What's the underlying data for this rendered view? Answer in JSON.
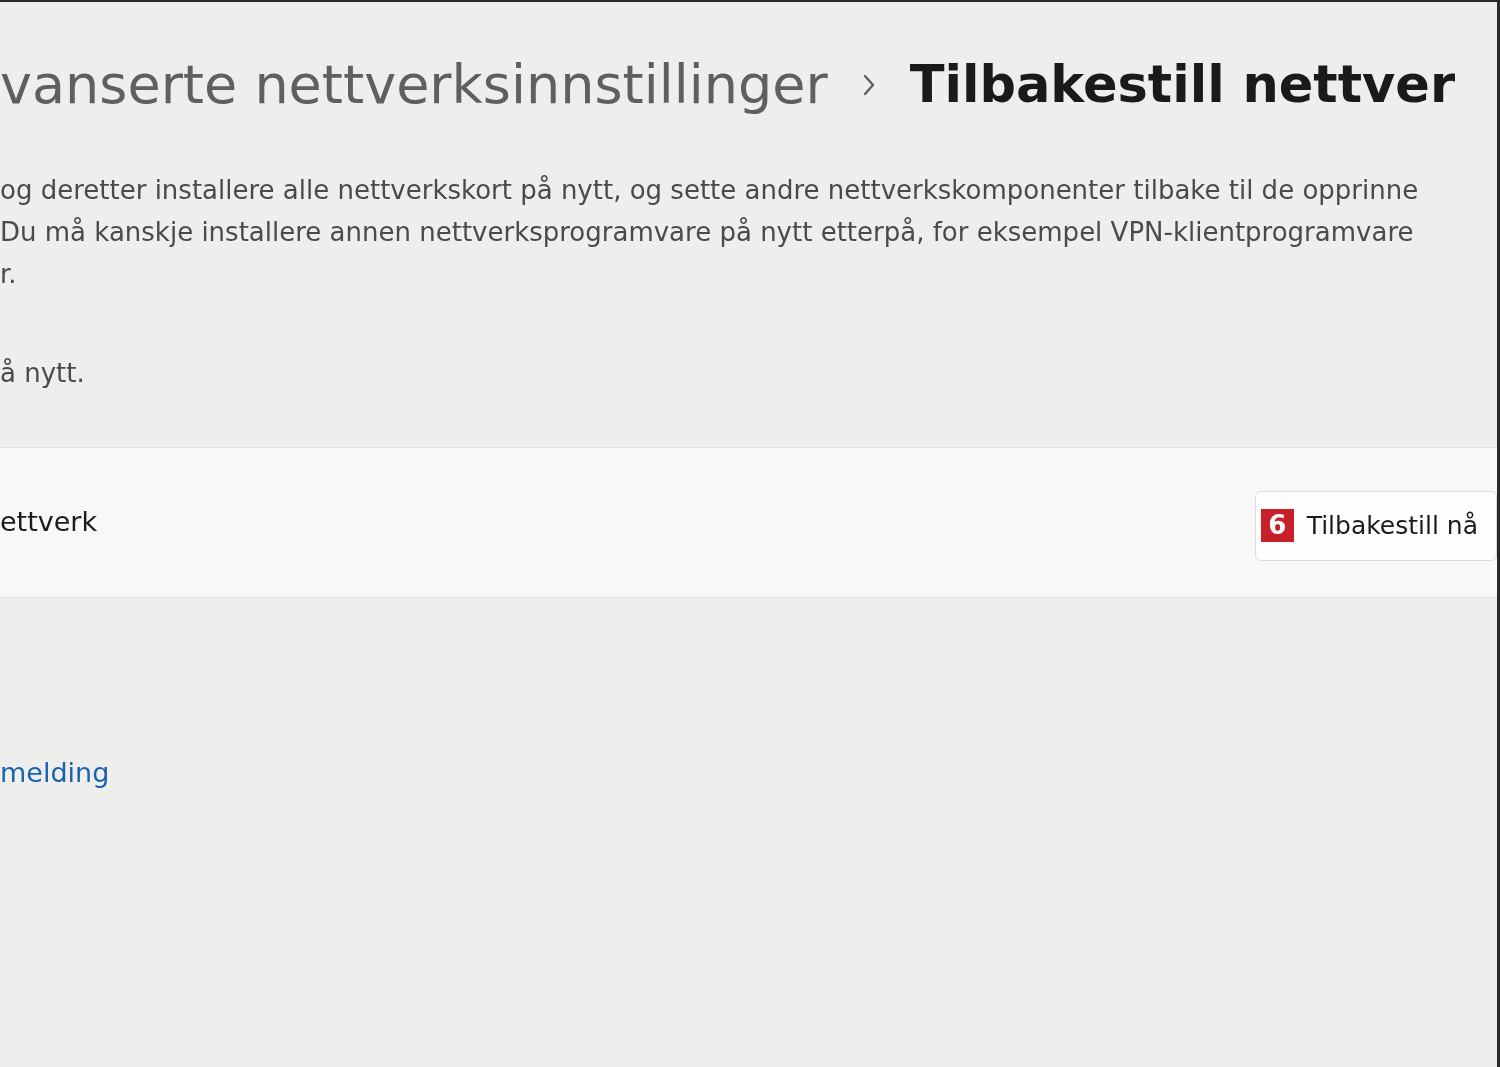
{
  "breadcrumb": {
    "items": [
      {
        "label": "vanserte nettverksinnstillinger",
        "current": false
      },
      {
        "label": "Tilbakestill nettver",
        "current": true
      }
    ]
  },
  "description": {
    "lines": [
      "og deretter installere alle nettverkskort på nytt, og sette andre nettverkskomponenter tilbake til de opprinne",
      "Du må kanskje installere annen nettverksprogramvare på nytt etterpå, for eksempel VPN-klientprogramvare",
      "r."
    ],
    "note": "å nytt."
  },
  "setting_row": {
    "label": "ettverk",
    "button": {
      "badge": "6",
      "label": "Tilbakestill nå"
    }
  },
  "link": {
    "label": "melding"
  }
}
